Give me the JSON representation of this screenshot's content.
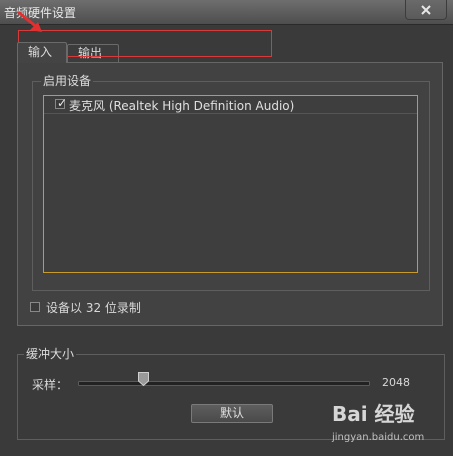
{
  "window": {
    "title": "音频硬件设置"
  },
  "tabs": [
    {
      "label": "输入",
      "active": true
    },
    {
      "label": "输出",
      "active": false
    }
  ],
  "enabled_devices": {
    "group_label": "启用设备",
    "devices": [
      {
        "label": "麦克风 (Realtek High Definition Audio)",
        "checked": true
      }
    ]
  },
  "record32": {
    "label": "设备以 32 位录制",
    "checked": false
  },
  "buffer": {
    "group_label": "缓冲大小",
    "sample_label": "采样：",
    "sample_value": "2048",
    "slider_fraction": 0.22,
    "default_button_label": "默认"
  },
  "watermark": {
    "logo_text": "Bai 经验",
    "sub_text": "jingyan.baidu.com"
  },
  "colors": {
    "list_border": "#c89a28",
    "highlight": "#d83a3a"
  }
}
